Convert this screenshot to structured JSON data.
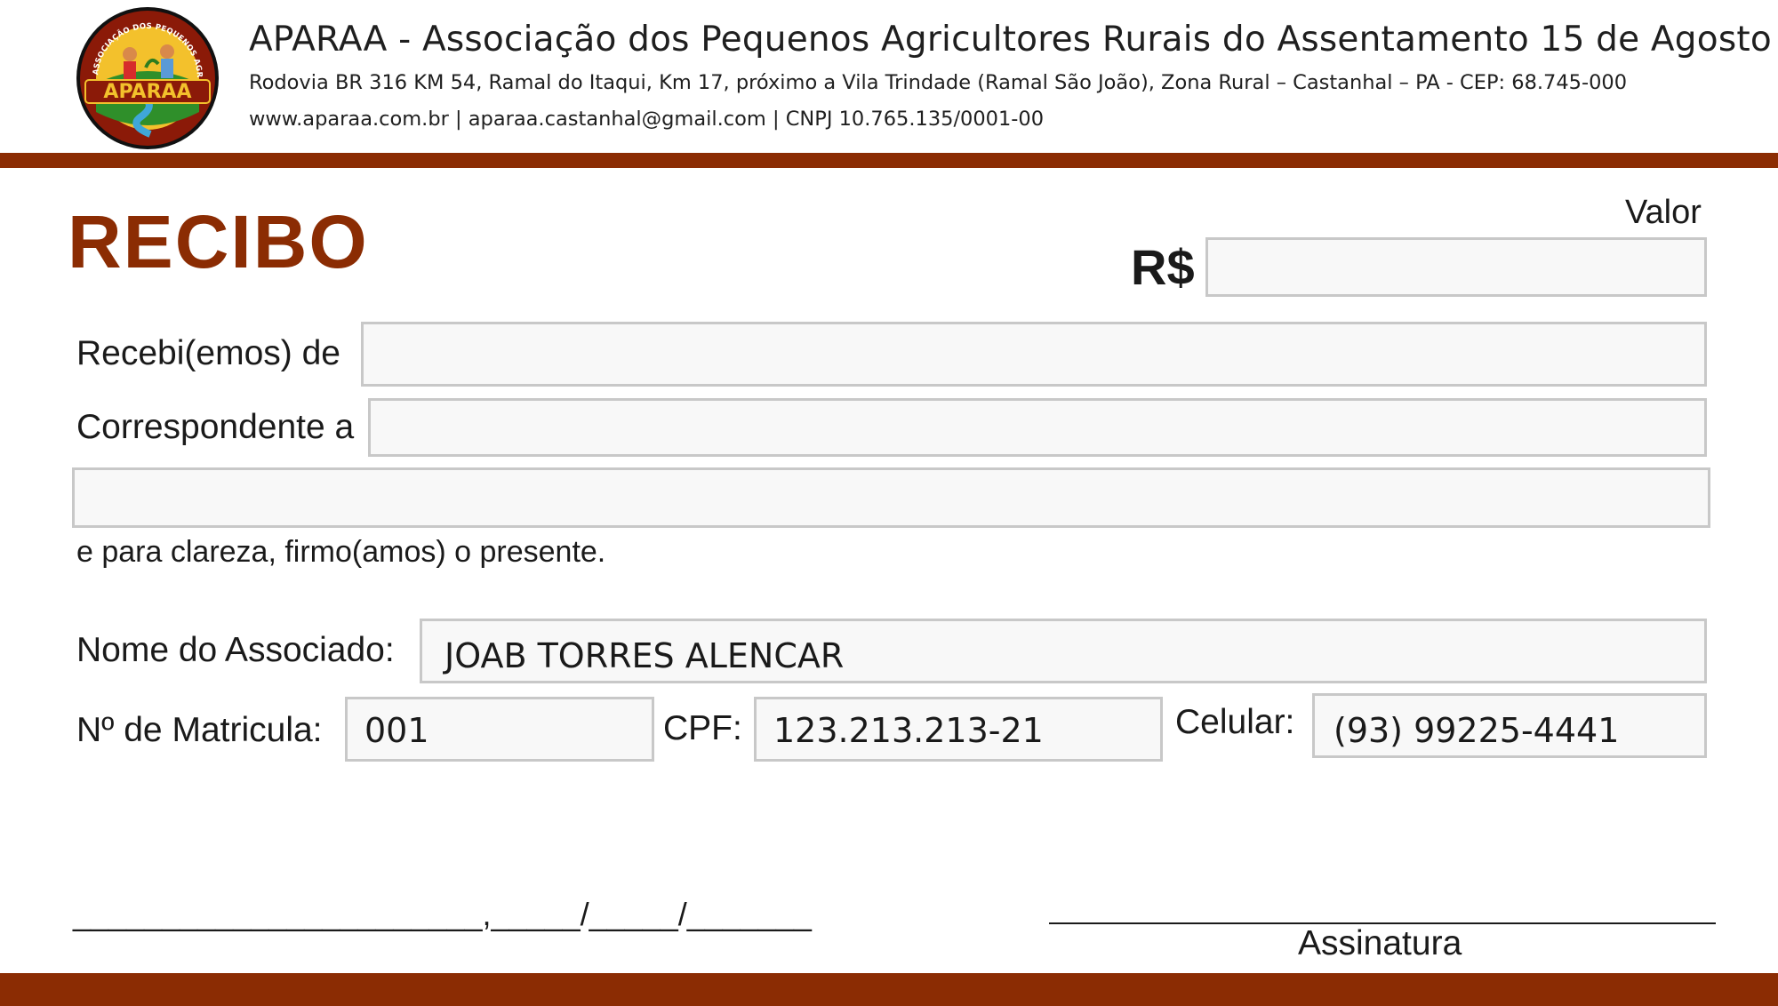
{
  "header": {
    "logo_text": "APARAA",
    "logo_ring_text": "ASSOCIAÇÃO DOS PEQUENOS AGRICULTORES DO ASSENTAMENTO 15 DE AGOSTO",
    "title": "APARAA - Associação dos Pequenos Agricultores Rurais do Assentamento 15 de Agosto",
    "address": "Rodovia BR 316 KM 54, Ramal do Itaqui, Km 17, próximo a Vila Trindade (Ramal São João), Zona Rural – Castanhal – PA - CEP: 68.745-000",
    "contact": "www.aparaa.com.br | aparaa.castanhal@gmail.com | CNPJ 10.765.135/0001-00"
  },
  "receipt": {
    "title": "RECIBO",
    "value_label": "Valor",
    "currency_symbol": "R$",
    "value": "",
    "received_from_label": "Recebi(emos) de",
    "received_from": "",
    "corresponding_label": "Correspondente a",
    "corresponding": "",
    "corresponding_cont": "",
    "clarity_text": "e para clareza, firmo(amos) o presente."
  },
  "member": {
    "name_label": "Nome do Associado:",
    "name": "JOAB TORRES ALENCAR",
    "registration_label": "Nº de Matricula:",
    "registration": "001",
    "cpf_label": "CPF:",
    "cpf": "123.213.213-21",
    "phone_label": "Celular:",
    "phone": "(93) 99225-4441"
  },
  "footer": {
    "date_line": "_______________________,_____/_____/_______",
    "signature_label": "Assinatura"
  },
  "colors": {
    "brand": "#8b2c03",
    "field_border": "#c8c8c8",
    "field_bg": "#f8f8f8"
  }
}
